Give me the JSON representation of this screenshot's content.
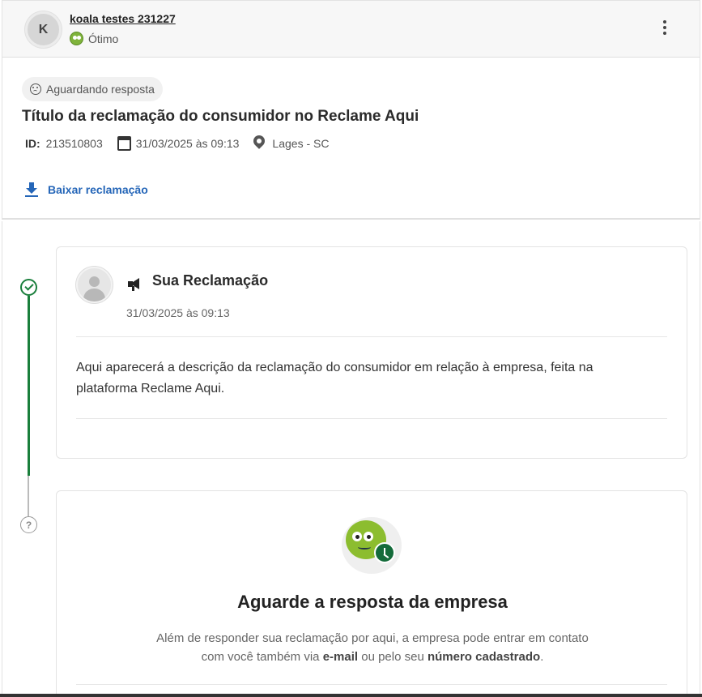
{
  "header": {
    "avatar_letter": "K",
    "company_name": "koala testes 231227",
    "reputation": "Ótimo"
  },
  "complaint": {
    "status": "Aguardando resposta",
    "title": "Título da reclamação do consumidor no Reclame Aqui",
    "id_label": "ID:",
    "id_value": "213510803",
    "date": "31/03/2025 às 09:13",
    "location": "Lages - SC",
    "download_label": "Baixar reclamação"
  },
  "timeline": {
    "complaint_card": {
      "title": "Sua Reclamação",
      "date": "31/03/2025 às 09:13",
      "description": "Aqui aparecerá a descrição da reclamação do consumidor em relação à empresa, feita na plataforma Reclame Aqui."
    },
    "waiting_card": {
      "title": "Aguarde a resposta da empresa",
      "text_1": "Além de responder sua reclamação por aqui, a empresa pode entrar em contato com você também via ",
      "text_bold_1": "e-mail",
      "text_2": " ou pelo seu ",
      "text_bold_2": "número cadastrado",
      "text_3": "."
    }
  },
  "colors": {
    "accent_green": "#1a7f3c",
    "link_blue": "#2566b8"
  }
}
